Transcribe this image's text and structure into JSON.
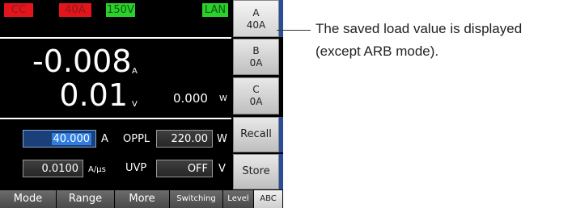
{
  "status_bar": {
    "mode_chip": "CC",
    "current_range_chip": "40A",
    "voltage_range_chip": "150V",
    "interface_chip": "LAN"
  },
  "measurement": {
    "current_value": "-0.008",
    "current_unit": "A",
    "voltage_value": "0.01",
    "voltage_unit": "V",
    "power_value": "0.000",
    "power_unit": "W"
  },
  "settings": {
    "current_set": "40.000",
    "current_set_unit": "A",
    "oppl_label": "OPPL",
    "oppl_value": "220.00",
    "oppl_unit": "W",
    "slew_value": "0.0100",
    "slew_unit": "A/µs",
    "uvp_label": "UVP",
    "uvp_value": "OFF",
    "uvp_unit": "V"
  },
  "soft_keys": [
    {
      "line1": "A",
      "line2": "40A"
    },
    {
      "line1": "B",
      "line2": "0A"
    },
    {
      "line1": "C",
      "line2": "0A"
    },
    {
      "line1": "Recall",
      "line2": ""
    },
    {
      "line1": "Store",
      "line2": ""
    }
  ],
  "function_keys": [
    "Mode",
    "Range",
    "More",
    "Switching",
    "Level",
    "ABC"
  ],
  "callout": {
    "line1": "The saved load value is displayed",
    "line2": "(except ARB mode)."
  },
  "colors": {
    "red_chip": "#e3141b",
    "green_chip": "#2bd12b",
    "active_field": "#2f7de0",
    "softkey_edge": "#2a4e96"
  }
}
